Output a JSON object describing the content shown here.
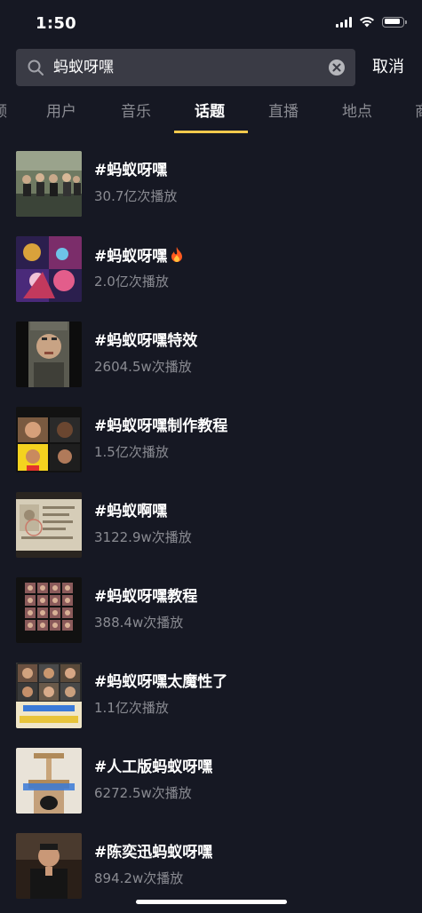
{
  "status_bar": {
    "time": "1:50",
    "battery_level": 0.9
  },
  "search": {
    "query": "蚂蚁呀嘿",
    "cancel_label": "取消"
  },
  "tabs": [
    {
      "label": "频",
      "active": false
    },
    {
      "label": "用户",
      "active": false
    },
    {
      "label": "音乐",
      "active": false
    },
    {
      "label": "话题",
      "active": true
    },
    {
      "label": "直播",
      "active": false
    },
    {
      "label": "地点",
      "active": false
    },
    {
      "label": "商",
      "active": false
    }
  ],
  "topics": [
    {
      "title": "#蚂蚁呀嘿",
      "plays": "30.7亿次播放",
      "fire": false
    },
    {
      "title": "#蚂蚁呀嘿",
      "plays": "2.0亿次播放",
      "fire": true
    },
    {
      "title": "#蚂蚁呀嘿特效",
      "plays": "2604.5w次播放",
      "fire": false
    },
    {
      "title": "#蚂蚁呀嘿制作教程",
      "plays": "1.5亿次播放",
      "fire": false
    },
    {
      "title": "#蚂蚁啊嘿",
      "plays": "3122.9w次播放",
      "fire": false
    },
    {
      "title": "#蚂蚁呀嘿教程",
      "plays": "388.4w次播放",
      "fire": false
    },
    {
      "title": "#蚂蚁呀嘿太魔性了",
      "plays": "1.1亿次播放",
      "fire": false
    },
    {
      "title": "#人工版蚂蚁呀嘿",
      "plays": "6272.5w次播放",
      "fire": false
    },
    {
      "title": "#陈奕迅蚂蚁呀嘿",
      "plays": "894.2w次播放",
      "fire": false
    }
  ],
  "colors": {
    "background": "#161823",
    "accent_underline": "#f2c94c",
    "secondary_text": "#8a8b92",
    "search_box": "#3a3b45",
    "fire": "#ff5a1f"
  }
}
